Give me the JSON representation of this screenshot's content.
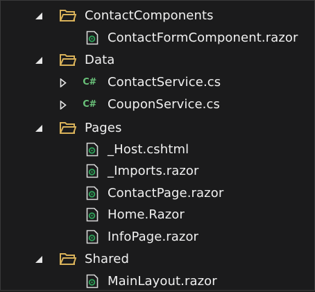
{
  "explorer": {
    "items": [
      {
        "name": "ContactComponents",
        "kind": "folder",
        "expanded": true,
        "toggle": "expanded"
      },
      {
        "name": "ContactFormComponent.razor",
        "kind": "razor-file"
      },
      {
        "name": "Data",
        "kind": "folder",
        "expanded": true,
        "toggle": "expanded"
      },
      {
        "name": "ContactService.cs",
        "kind": "csharp-file",
        "toggle": "collapsed"
      },
      {
        "name": "CouponService.cs",
        "kind": "csharp-file",
        "toggle": "collapsed"
      },
      {
        "name": "Pages",
        "kind": "folder",
        "expanded": true,
        "toggle": "expanded"
      },
      {
        "name": "_Host.cshtml",
        "kind": "razor-file"
      },
      {
        "name": "_Imports.razor",
        "kind": "razor-file"
      },
      {
        "name": "ContactPage.razor",
        "kind": "razor-file"
      },
      {
        "name": "Home.Razor",
        "kind": "razor-file"
      },
      {
        "name": "InfoPage.razor",
        "kind": "razor-file"
      },
      {
        "name": "Shared",
        "kind": "folder",
        "expanded": true,
        "toggle": "expanded"
      },
      {
        "name": "MainLayout.razor",
        "kind": "razor-file"
      }
    ],
    "csharp_icon_text": "C#"
  },
  "colors": {
    "background": "#1b1b1c",
    "text": "#f1f1f1",
    "folder": "#d9b25a",
    "csharp": "#6ac27a",
    "razor_file_border": "#d8d8d8",
    "razor_file_mark": "#2e9c57"
  }
}
